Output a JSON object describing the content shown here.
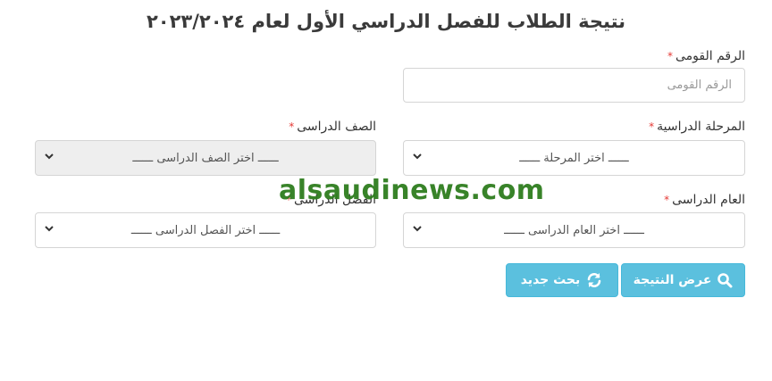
{
  "page": {
    "title": "نتيجة الطلاب للفصل الدراسي الأول لعام ٢٠٢٣/٢٠٢٤"
  },
  "form": {
    "required_mark": "*",
    "national_id": {
      "label": "الرقم القومى",
      "placeholder": "الرقم القومى"
    },
    "stage": {
      "label": "المرحلة الدراسية",
      "selected": "ــــــ اختر المرحلة ــــــ"
    },
    "grade": {
      "label": "الصف الدراسى",
      "selected": "ــــــ اختر الصف الدراسى ــــــ"
    },
    "year": {
      "label": "العام الدراسى",
      "selected": "ــــــ اختر العام الدراسى ــــــ"
    },
    "term": {
      "label": "الفصل الدراسى",
      "selected": "ــــــ اختر الفصل الدراسى ــــــ"
    }
  },
  "buttons": {
    "show_result": "عرض النتيجة",
    "new_search": "بحث جديد"
  },
  "watermark": {
    "text": "alsaudinews.com"
  },
  "colors": {
    "button": "#5bc0de",
    "required": "#e53935",
    "watermark": "#2e7d1e"
  }
}
